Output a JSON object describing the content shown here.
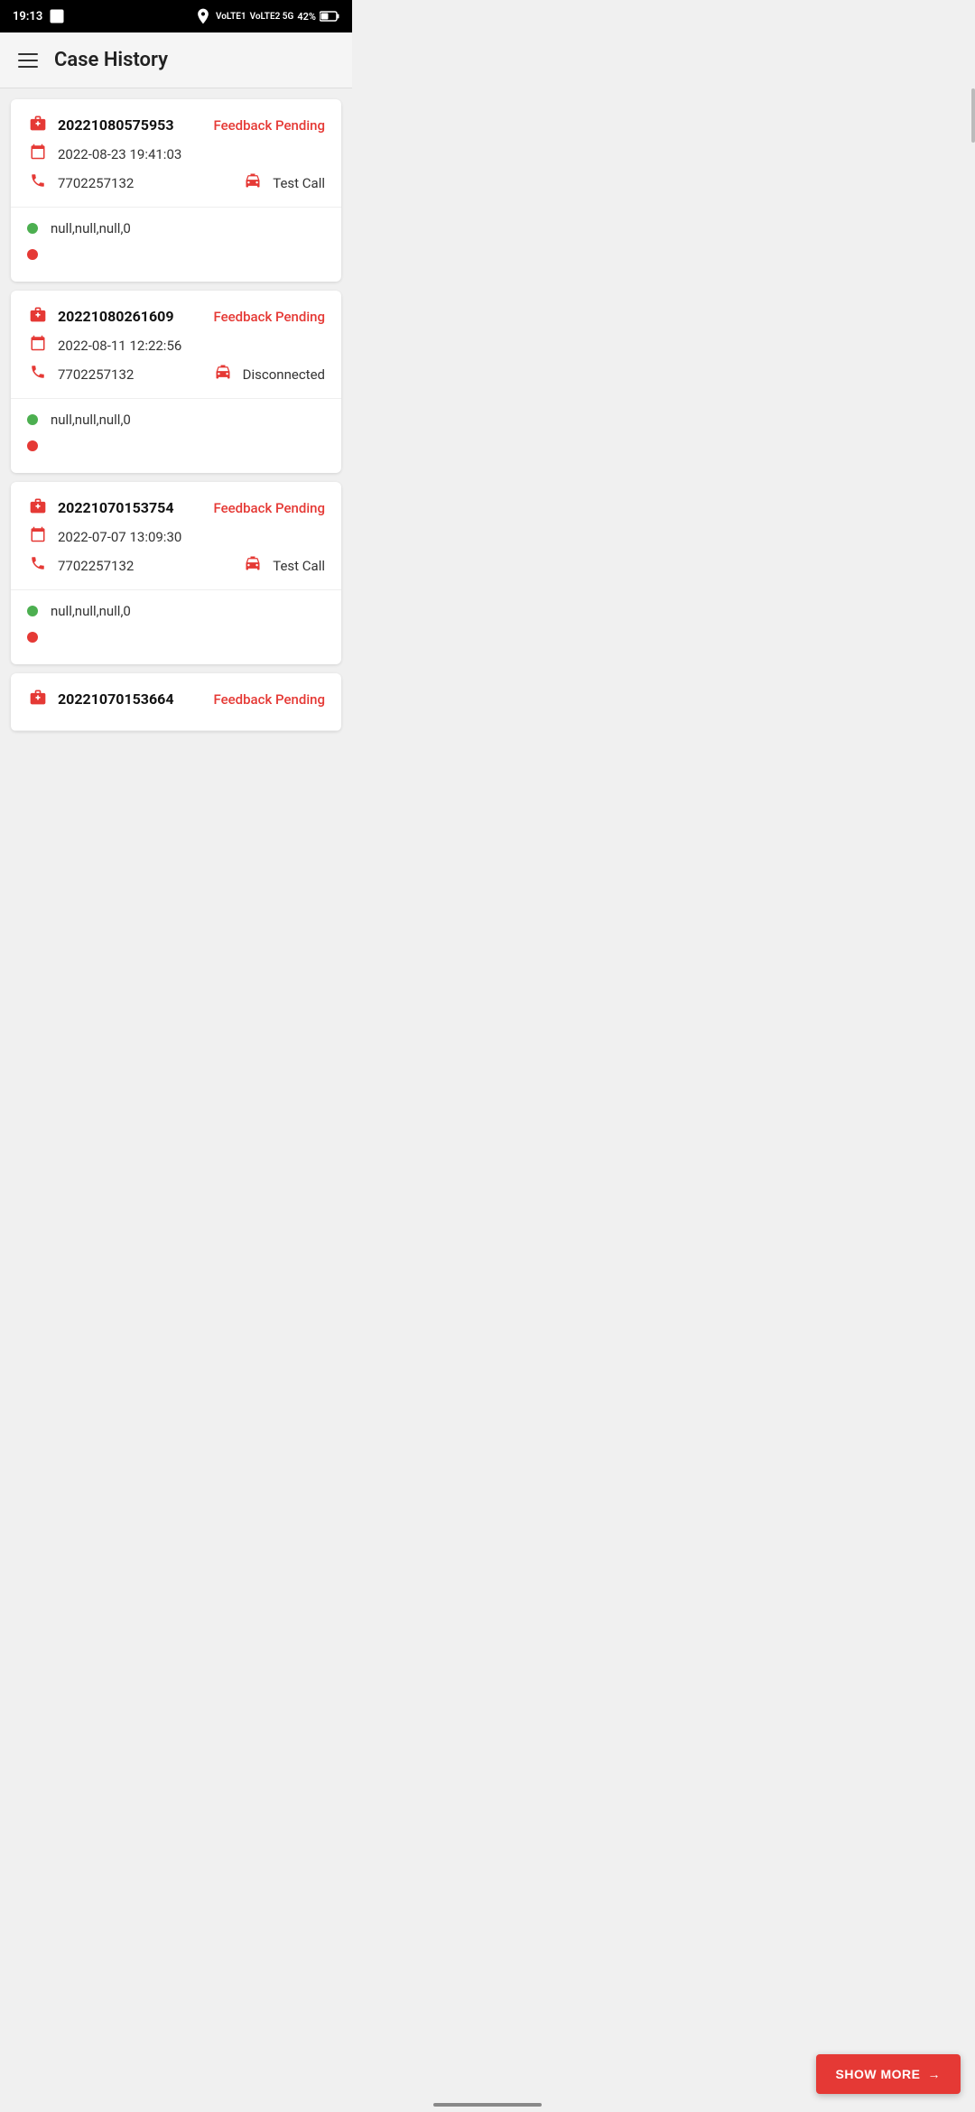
{
  "status_bar": {
    "time": "19:13",
    "battery": "42%"
  },
  "header": {
    "title": "Case History",
    "menu_icon": "☰"
  },
  "cases": [
    {
      "id": "20221080575953",
      "feedback_status": "Feedback Pending",
      "date": "2022-08-23 19:41:03",
      "phone": "7702257132",
      "call_type": "Test Call",
      "status_green": "null,null,null,0",
      "status_red": ""
    },
    {
      "id": "20221080261609",
      "feedback_status": "Feedback Pending",
      "date": "2022-08-11 12:22:56",
      "phone": "7702257132",
      "call_type": "Disconnected",
      "status_green": "null,null,null,0",
      "status_red": ""
    },
    {
      "id": "20221070153754",
      "feedback_status": "Feedback Pending",
      "date": "2022-07-07 13:09:30",
      "phone": "7702257132",
      "call_type": "Test Call",
      "status_green": "null,null,null,0",
      "status_red": ""
    },
    {
      "id": "20221070153664",
      "feedback_status": "Feedback Pending",
      "date": "",
      "phone": "",
      "call_type": "",
      "status_green": "",
      "status_red": ""
    }
  ],
  "show_more_button": {
    "label": "SHOW MORE",
    "arrow": "→"
  }
}
